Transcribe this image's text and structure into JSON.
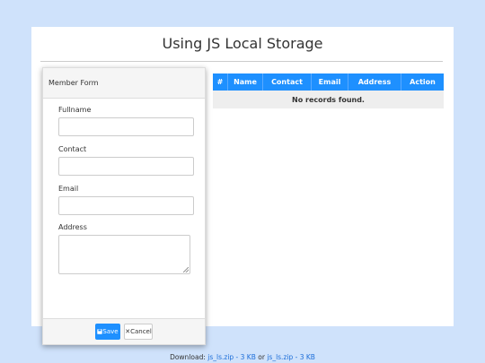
{
  "page": {
    "title": "Using JS Local Storage"
  },
  "form": {
    "header": "Member Form",
    "fields": [
      {
        "label": "Fullname",
        "value": ""
      },
      {
        "label": "Contact",
        "value": ""
      },
      {
        "label": "Email",
        "value": ""
      },
      {
        "label": "Address",
        "value": ""
      }
    ],
    "save_label": "Save",
    "cancel_label": "Cancel"
  },
  "table": {
    "columns": [
      "#",
      "Name",
      "Contact",
      "Email",
      "Address",
      "Action"
    ],
    "empty_message": "No records found."
  },
  "footer": {
    "prefix": "Download:",
    "link1": "js_ls.zip - 3 KB",
    "middle": "or",
    "link2": "js_ls.zip - 3 KB"
  },
  "colors": {
    "background": "#cfe2fb",
    "accent": "#1e90ff"
  }
}
